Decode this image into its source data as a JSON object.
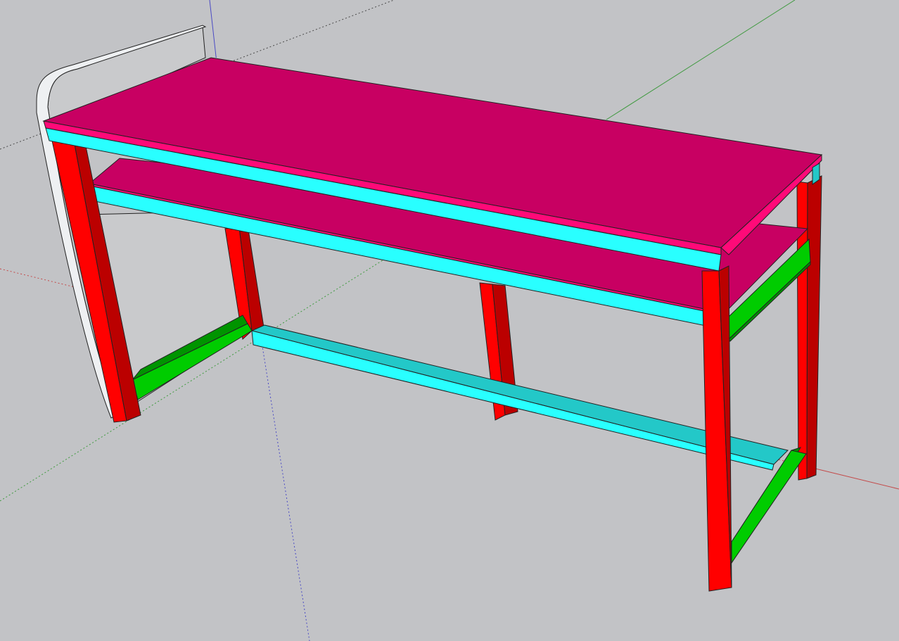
{
  "scene": {
    "background": "#c2c3c6",
    "axes": {
      "red": "#c44a4a",
      "green": "#3f9a3f",
      "blue": "#4a4ac4",
      "inferred": "#4a4a4a"
    },
    "materials": {
      "tops": {
        "top": "#c80062",
        "edge": "#ff0a78"
      },
      "aprons": {
        "face": "#29ffff",
        "dark": "#23c8c8"
      },
      "legs": {
        "face": "#ff0000",
        "dark": "#bb0000"
      },
      "side_rails": {
        "face": "#00cc00",
        "dark": "#009400"
      },
      "side_panel": {
        "face": "#c9cacc",
        "edge": "#eef0f2",
        "outline": "#222222"
      }
    }
  }
}
